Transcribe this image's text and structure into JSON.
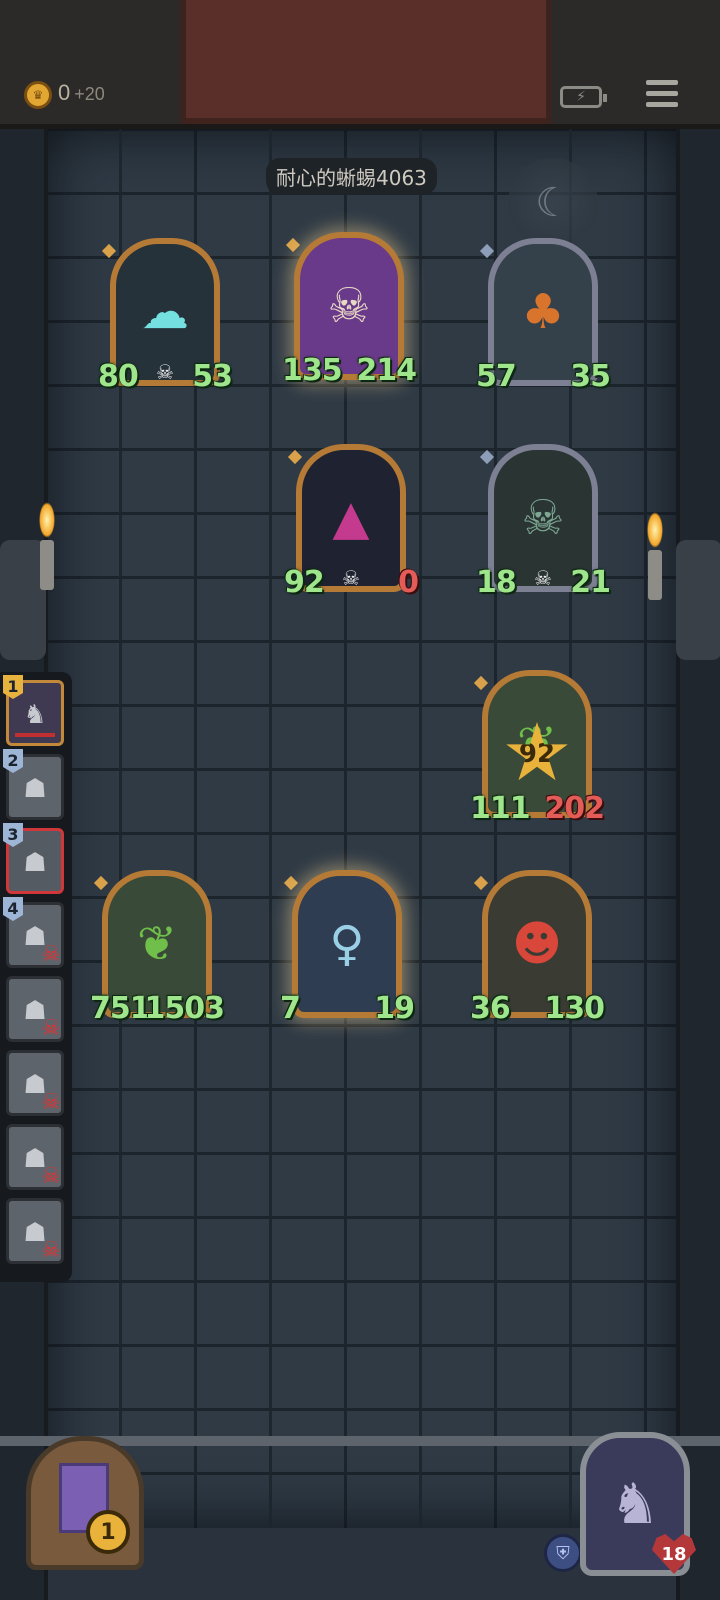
{
  "top_bar": {
    "coins": "0",
    "coin_bonus": "+20",
    "coin_icon": "crown-coin-icon",
    "battery_icon": "battery-saver-icon",
    "menu_icon": "menu-icon"
  },
  "opponent": {
    "name": "耐心的蜥蜴4063",
    "ability_icon": "scythe-icon"
  },
  "enemy_board": [
    {
      "name": "ghost-flame",
      "atk": "80",
      "hp": "53",
      "frame": "gold",
      "icon": "ghost-icon",
      "skull": true
    },
    {
      "name": "pirate-captain",
      "atk": "135",
      "hp": "214",
      "frame": "gold",
      "icon": "pirate-icon",
      "skull": false
    },
    {
      "name": "pumpkin-knight",
      "atk": "57",
      "hp": "35",
      "frame": "silver",
      "icon": "pumpkin-icon",
      "skull": false
    },
    {
      "name": "dark-wizard",
      "atk": "92",
      "hp": "0",
      "frame": "gold",
      "icon": "wizard-icon",
      "skull": true
    },
    {
      "name": "skeleton-warrior",
      "atk": "18",
      "hp": "21",
      "frame": "silver",
      "icon": "skeleton-icon",
      "skull": true
    }
  ],
  "player_board": [
    {
      "name": "mandrake",
      "atk": "111",
      "hp": "202",
      "badge": "92",
      "frame": "gold",
      "icon": "leaf-icon"
    },
    {
      "name": "leaf-girl",
      "atk": "751",
      "hp": "1503",
      "frame": "gold",
      "icon": "leaf-icon"
    },
    {
      "name": "elf-sorceress",
      "atk": "7",
      "hp": "19",
      "frame": "gold",
      "icon": "elf-icon"
    },
    {
      "name": "grinning-imp",
      "atk": "36",
      "hp": "130",
      "frame": "gold",
      "icon": "imp-icon"
    }
  ],
  "queue": [
    {
      "number": "1",
      "state": "active"
    },
    {
      "number": "2",
      "state": "waiting"
    },
    {
      "number": "3",
      "state": "current"
    },
    {
      "number": "4",
      "state": "defeated"
    },
    {
      "number": "",
      "state": "defeated"
    },
    {
      "number": "",
      "state": "defeated"
    },
    {
      "number": "",
      "state": "defeated"
    },
    {
      "number": "",
      "state": "defeated"
    }
  ],
  "bottom": {
    "deck_count": "1",
    "hero_health": "18",
    "shield_icon": "shield-icon"
  },
  "colors": {
    "stat_green": "#9fe58c",
    "stat_red": "#e35c57",
    "frame_gold": "#b57a35",
    "frame_silver": "#7d7f93"
  }
}
